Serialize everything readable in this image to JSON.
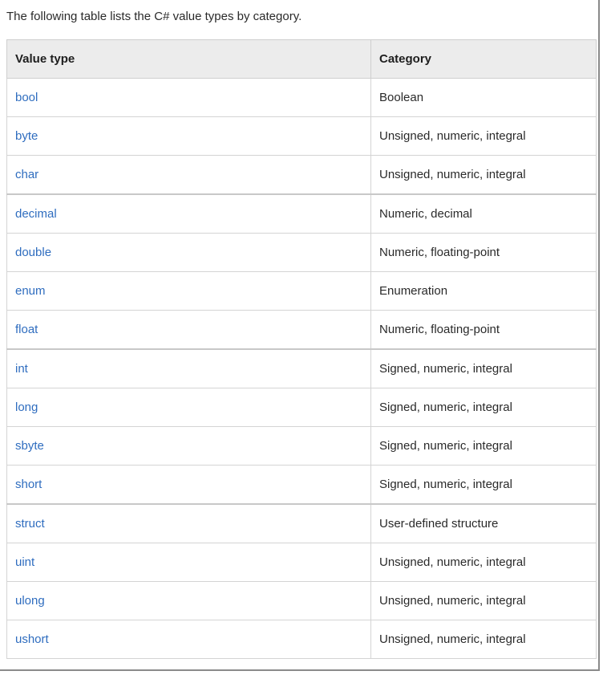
{
  "intro": "The following table lists the C# value types by category.",
  "table": {
    "headers": {
      "value_type": "Value type",
      "category": "Category"
    },
    "rows": [
      {
        "type": "bool",
        "category": "Boolean"
      },
      {
        "type": "byte",
        "category": "Unsigned, numeric, integral"
      },
      {
        "type": "char",
        "category": "Unsigned, numeric, integral"
      },
      {
        "type": "decimal",
        "category": "Numeric, decimal"
      },
      {
        "type": "double",
        "category": "Numeric, floating-point"
      },
      {
        "type": "enum",
        "category": "Enumeration"
      },
      {
        "type": "float",
        "category": "Numeric, floating-point"
      },
      {
        "type": "int",
        "category": "Signed, numeric, integral"
      },
      {
        "type": "long",
        "category": "Signed, numeric, integral"
      },
      {
        "type": "sbyte",
        "category": "Signed, numeric, integral"
      },
      {
        "type": "short",
        "category": "Signed, numeric, integral"
      },
      {
        "type": "struct",
        "category": "User-defined structure"
      },
      {
        "type": "uint",
        "category": "Unsigned, numeric, integral"
      },
      {
        "type": "ulong",
        "category": "Unsigned, numeric, integral"
      },
      {
        "type": "ushort",
        "category": "Unsigned, numeric, integral"
      }
    ]
  },
  "colors": {
    "link": "#2f6dbf",
    "header_background": "#ececec",
    "border": "#d4d4d4",
    "text": "#1e1e1e"
  }
}
